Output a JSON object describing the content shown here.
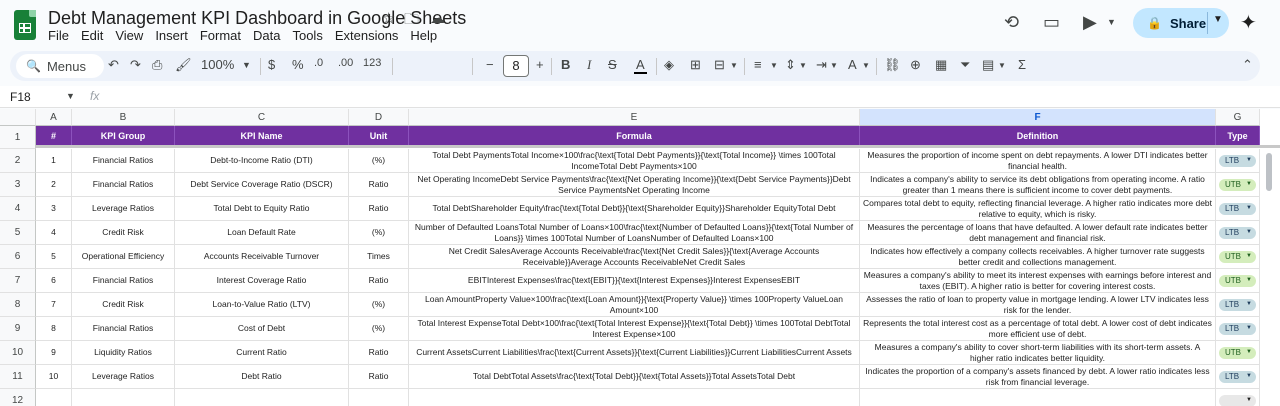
{
  "app": {
    "doc_title": "Debt Management KPI Dashboard in Google Sheets",
    "menu": [
      "File",
      "Edit",
      "View",
      "Insert",
      "Format",
      "Data",
      "Tools",
      "Extensions",
      "Help"
    ],
    "share_label": "Share"
  },
  "toolbar": {
    "search_label": "Menus",
    "zoom": "100%",
    "currency": "$",
    "percent": "%",
    "dec_decrease": ".0",
    "dec_increase": ".00",
    "number_format": "123",
    "font_size": "8",
    "bold": "B",
    "italic": "I",
    "minus": "−",
    "plus": "+"
  },
  "formula_bar": {
    "cell_ref": "F18",
    "fx": "fx",
    "value": ""
  },
  "sheet": {
    "columns": [
      "A",
      "B",
      "C",
      "D",
      "E",
      "F",
      "G"
    ],
    "selected_column": "F",
    "headers": [
      "#",
      "KPI Group",
      "KPI Name",
      "Unit",
      "Formula",
      "Definition",
      "Type"
    ],
    "rows": [
      {
        "num": "1",
        "group": "Financial Ratios",
        "name": "Debt-to-Income Ratio (DTI)",
        "unit": "(%)",
        "formula": "Total Debt PaymentsTotal Income×100\\frac{\\text{Total Debt Payments}}{\\text{Total Income}} \\times 100Total IncomeTotal Debt Payments×100",
        "definition": "Measures the proportion of income spent on debt repayments. A lower DTI indicates better financial health.",
        "type": "LTB"
      },
      {
        "num": "2",
        "group": "Financial Ratios",
        "name": "Debt Service Coverage Ratio (DSCR)",
        "unit": "Ratio",
        "formula": "Net Operating IncomeDebt Service Payments\\frac{\\text{Net Operating Income}}{\\text{Debt Service Payments}}Debt Service PaymentsNet Operating Income",
        "definition": "Indicates a company's ability to service its debt obligations from operating income. A ratio greater than 1 means there is sufficient income to cover debt payments.",
        "type": "UTB"
      },
      {
        "num": "3",
        "group": "Leverage Ratios",
        "name": "Total Debt to Equity Ratio",
        "unit": "Ratio",
        "formula": "Total DebtShareholder Equity\\frac{\\text{Total Debt}}{\\text{Shareholder Equity}}Shareholder EquityTotal Debt",
        "definition": "Compares total debt to equity, reflecting financial leverage. A higher ratio indicates more debt relative to equity, which is risky.",
        "type": "LTB"
      },
      {
        "num": "4",
        "group": "Credit Risk",
        "name": "Loan Default Rate",
        "unit": "(%)",
        "formula": "Number of Defaulted LoansTotal Number of Loans×100\\frac{\\text{Number of Defaulted Loans}}{\\text{Total Number of Loans}} \\times 100Total Number of LoansNumber of Defaulted Loans×100",
        "definition": "Measures the percentage of loans that have defaulted. A lower default rate indicates better debt management and financial risk.",
        "type": "LTB"
      },
      {
        "num": "5",
        "group": "Operational Efficiency",
        "name": "Accounts Receivable Turnover",
        "unit": "Times",
        "formula": "Net Credit SalesAverage Accounts Receivable\\frac{\\text{Net Credit Sales}}{\\text{Average Accounts Receivable}}Average Accounts ReceivableNet Credit Sales",
        "definition": "Indicates how effectively a company collects receivables. A higher turnover rate suggests better credit and collections management.",
        "type": "UTB"
      },
      {
        "num": "6",
        "group": "Financial Ratios",
        "name": "Interest Coverage Ratio",
        "unit": "Ratio",
        "formula": "EBITInterest Expenses\\frac{\\text{EBIT}}{\\text{Interest Expenses}}Interest ExpensesEBIT",
        "definition": "Measures a company's ability to meet its interest expenses with earnings before interest and taxes (EBIT). A higher ratio is better for covering interest costs.",
        "type": "UTB"
      },
      {
        "num": "7",
        "group": "Credit Risk",
        "name": "Loan-to-Value Ratio (LTV)",
        "unit": "(%)",
        "formula": "Loan AmountProperty Value×100\\frac{\\text{Loan Amount}}{\\text{Property Value}} \\times 100Property ValueLoan Amount×100",
        "definition": "Assesses the ratio of loan to property value in mortgage lending. A lower LTV indicates less risk for the lender.",
        "type": "LTB"
      },
      {
        "num": "8",
        "group": "Financial Ratios",
        "name": "Cost of Debt",
        "unit": "(%)",
        "formula": "Total Interest ExpenseTotal Debt×100\\frac{\\text{Total Interest Expense}}{\\text{Total Debt}} \\times 100Total DebtTotal Interest Expense×100",
        "definition": "Represents the total interest cost as a percentage of total debt. A lower cost of debt indicates more efficient use of debt.",
        "type": "LTB"
      },
      {
        "num": "9",
        "group": "Liquidity Ratios",
        "name": "Current Ratio",
        "unit": "Ratio",
        "formula": "Current AssetsCurrent Liabilities\\frac{\\text{Current Assets}}{\\text{Current Liabilities}}Current LiabilitiesCurrent Assets",
        "definition": "Measures a company's ability to cover short-term liabilities with its short-term assets. A higher ratio indicates better liquidity.",
        "type": "UTB"
      },
      {
        "num": "10",
        "group": "Leverage Ratios",
        "name": "Debt Ratio",
        "unit": "Ratio",
        "formula": "Total DebtTotal Assets\\frac{\\text{Total Debt}}{\\text{Total Assets}}Total AssetsTotal Debt",
        "definition": "Indicates the proportion of a company's assets financed by debt. A lower ratio indicates less risk from financial leverage.",
        "type": "LTB"
      }
    ],
    "row_numbers": [
      "1",
      "2",
      "3",
      "4",
      "5",
      "6",
      "7",
      "8",
      "9",
      "10",
      "11",
      "12"
    ]
  },
  "colors": {
    "header_bg": "#7030a0",
    "ltb_chip": "#c6dbe1",
    "utb_chip": "#d4edbc",
    "share_bg": "#c2e7ff"
  }
}
